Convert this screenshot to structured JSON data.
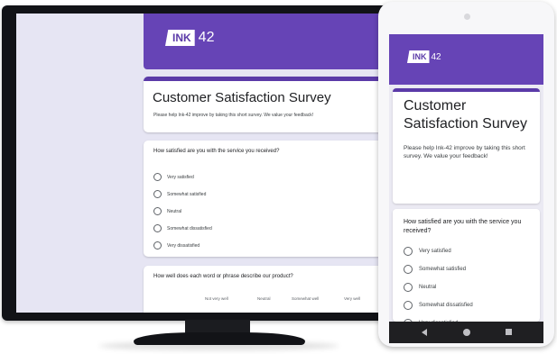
{
  "brand": {
    "logo_text": "INK",
    "logo_number": "42",
    "accent_color": "#6644b6"
  },
  "survey": {
    "title": "Customer Satisfaction Survey",
    "phone_title": "Customer Satisfaction Survey",
    "description": "Please help Ink-42 improve by taking this short survey. We value your feedback!",
    "question1": {
      "text": "How satisfied are you with the service you received?",
      "options": [
        "Very satisfied",
        "Somewhat satisfied",
        "Neutral",
        "Somewhat dissatisfied",
        "Very dissatisfied"
      ]
    },
    "question2": {
      "text": "How well does each word or phrase describe our product?",
      "scale": [
        "Not very well",
        "Neutral",
        "Somewhat well",
        "Very well"
      ]
    }
  }
}
